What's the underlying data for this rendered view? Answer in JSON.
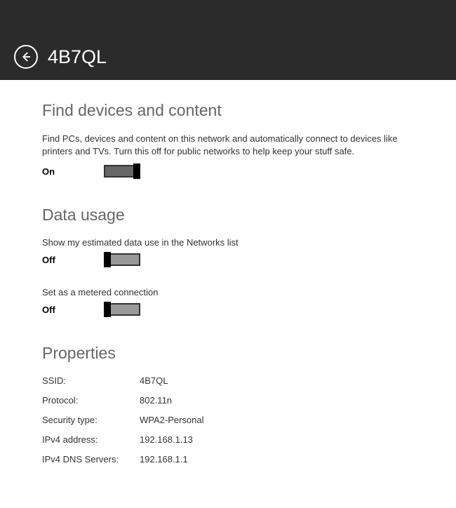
{
  "header": {
    "title": "4B7QL"
  },
  "sections": {
    "findDevices": {
      "title": "Find devices and content",
      "description": "Find PCs, devices and content on this network and automatically connect to devices like printers and TVs. Turn this off for public networks to help keep your stuff safe.",
      "toggleLabel": "On",
      "toggleState": "on"
    },
    "dataUsage": {
      "title": "Data usage",
      "showEstimated": {
        "label": "Show my estimated data use in the Networks list",
        "toggleLabel": "Off",
        "toggleState": "off"
      },
      "metered": {
        "label": "Set as a metered connection",
        "toggleLabel": "Off",
        "toggleState": "off"
      }
    },
    "properties": {
      "title": "Properties",
      "rows": [
        {
          "key": "SSID:",
          "value": "4B7QL"
        },
        {
          "key": "Protocol:",
          "value": "802.11n"
        },
        {
          "key": "Security type:",
          "value": "WPA2-Personal"
        },
        {
          "key": "IPv4 address:",
          "value": "192.168.1.13"
        },
        {
          "key": "IPv4 DNS Servers:",
          "value": "192.168.1.1"
        }
      ]
    }
  }
}
